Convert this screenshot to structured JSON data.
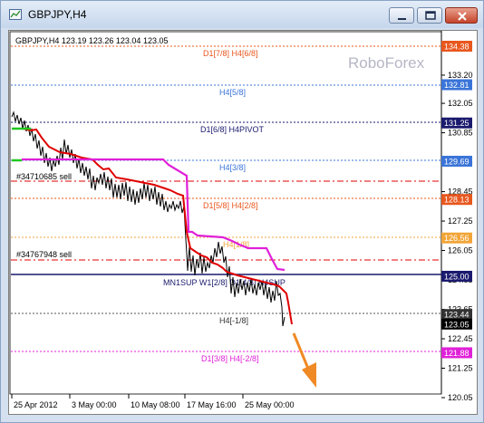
{
  "window": {
    "title": "GBPJPY,H4"
  },
  "header_text": "GBPJPY,H4  123.19 123.26 123.04 123.05",
  "watermark": "RoboForex",
  "price_axis": {
    "ticks": [
      "134.38",
      "133.20",
      "132.05",
      "130.85",
      "129.65",
      "128.45",
      "127.25",
      "126.05",
      "124.85",
      "123.65",
      "122.45",
      "121.25",
      "120.05"
    ]
  },
  "price_tags": [
    {
      "value": "134.38",
      "color": "#e8571e"
    },
    {
      "value": "132.81",
      "color": "#3a74d8"
    },
    {
      "value": "131.25",
      "color": "#1a1a6e"
    },
    {
      "value": "129.69",
      "color": "#3a74d8"
    },
    {
      "value": "128.13",
      "color": "#e8571e"
    },
    {
      "value": "126.56",
      "color": "#f2a63a"
    },
    {
      "value": "125.00",
      "color": "#1a1a6e"
    },
    {
      "value": "123.44",
      "color": "#333333"
    },
    {
      "value": "123.05",
      "color": "#000000"
    },
    {
      "value": "121.88",
      "color": "#e020d8"
    }
  ],
  "level_labels": [
    {
      "text": "D1[7/8] H4[6/8]",
      "color": "#e8571e"
    },
    {
      "text": "H4[5/8]",
      "color": "#3a74d8"
    },
    {
      "text": "D1[6/8] H4PIVOT",
      "color": "#1a1a6e"
    },
    {
      "text": "H4[3/8]",
      "color": "#3a74d8"
    },
    {
      "text": "D1[5/8] H4[2/8]",
      "color": "#e8571e"
    },
    {
      "text": "H4[1/8]",
      "color": "#f2a63a"
    },
    {
      "text": "MN1SUP W1[2/8] D1[4/8] H4SUP",
      "color": "#1a1a6e"
    },
    {
      "text": "H4[-1/8]",
      "color": "#333333"
    },
    {
      "text": "D1[3/8] H4[-2/8]",
      "color": "#e020d8"
    }
  ],
  "order_labels": [
    "#34710685 sell",
    "#34767948 sell"
  ],
  "time_axis": {
    "ticks": [
      "25 Apr 2012",
      "3 May 00:00",
      "10 May 08:00",
      "17 May 16:00",
      "25 May 00:00"
    ]
  },
  "colors": {
    "price_line": "#000000",
    "ma_red": "#e00000",
    "ma_magenta": "#e020d8",
    "ma_green": "#1ec81e",
    "forecast_arrow": "#f08a24"
  }
}
